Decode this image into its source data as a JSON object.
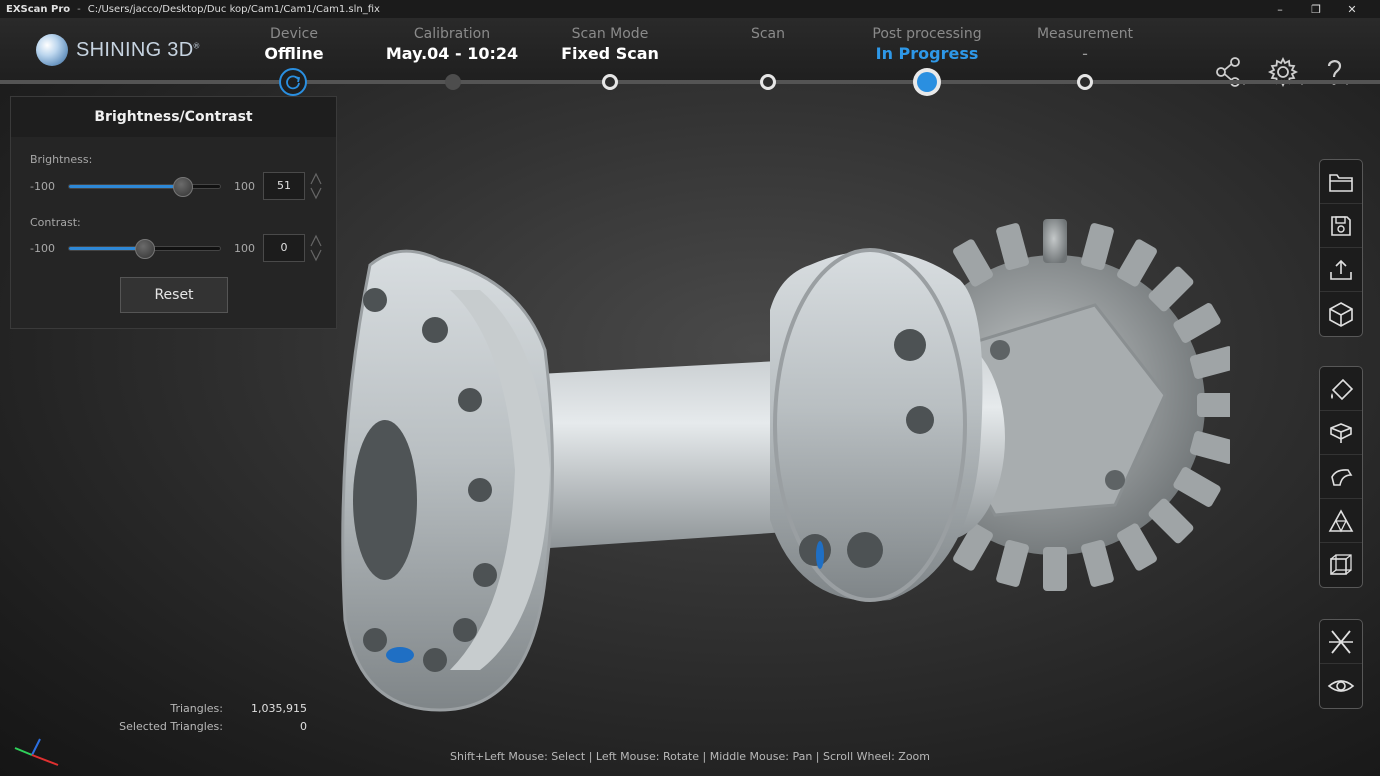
{
  "window": {
    "app_name": "EXScan Pro",
    "separator": "-",
    "file_path": "C:/Users/jacco/Desktop/Duc kop/Cam1/Cam1/Cam1.sln_fix",
    "minimize": "–",
    "restore": "❐",
    "close": "✕"
  },
  "brand": {
    "logo_text": "SHINING 3D",
    "reg_mark": "®"
  },
  "steps": [
    {
      "label": "Device",
      "value": "Offline",
      "state": "done"
    },
    {
      "label": "Calibration",
      "value": "May.04 - 10:24",
      "state": "done"
    },
    {
      "label": "Scan Mode",
      "value": "Fixed Scan",
      "state": "done"
    },
    {
      "label": "Scan",
      "value": "",
      "state": "todo"
    },
    {
      "label": "Post processing",
      "value": "In Progress",
      "state": "active"
    },
    {
      "label": "Measurement",
      "value": "-",
      "state": "todo"
    }
  ],
  "header_icons": [
    "share-icon",
    "settings-icon",
    "help-icon"
  ],
  "panel": {
    "title": "Brightness/Contrast",
    "brightness": {
      "label": "Brightness:",
      "min": "-100",
      "max": "100",
      "value": "51",
      "fraction": 0.755
    },
    "contrast": {
      "label": "Contrast:",
      "min": "-100",
      "max": "100",
      "value": "0",
      "fraction": 0.5
    },
    "reset_label": "Reset"
  },
  "toolbar_groups": [
    [
      "folder-open-icon",
      "save-icon",
      "export-icon",
      "model-cube-icon"
    ],
    [
      "fill-holes-icon",
      "cube-edit-icon",
      "smooth-icon",
      "mesh-simplify-icon",
      "wireframe-cube-icon"
    ],
    [
      "mirror-icon",
      "view-eye-icon"
    ]
  ],
  "stats": {
    "triangles_label": "Triangles:",
    "triangles_value": "1,035,915",
    "selected_label": "Selected Triangles:",
    "selected_value": "0"
  },
  "hint": "Shift+Left Mouse: Select | Left Mouse: Rotate | Middle Mouse: Pan | Scroll Wheel: Zoom",
  "colors": {
    "accent": "#2a8fe0",
    "active_step_text": "#2e98e8",
    "panel_bg": "#252525",
    "viewport_bg": "#333333"
  }
}
